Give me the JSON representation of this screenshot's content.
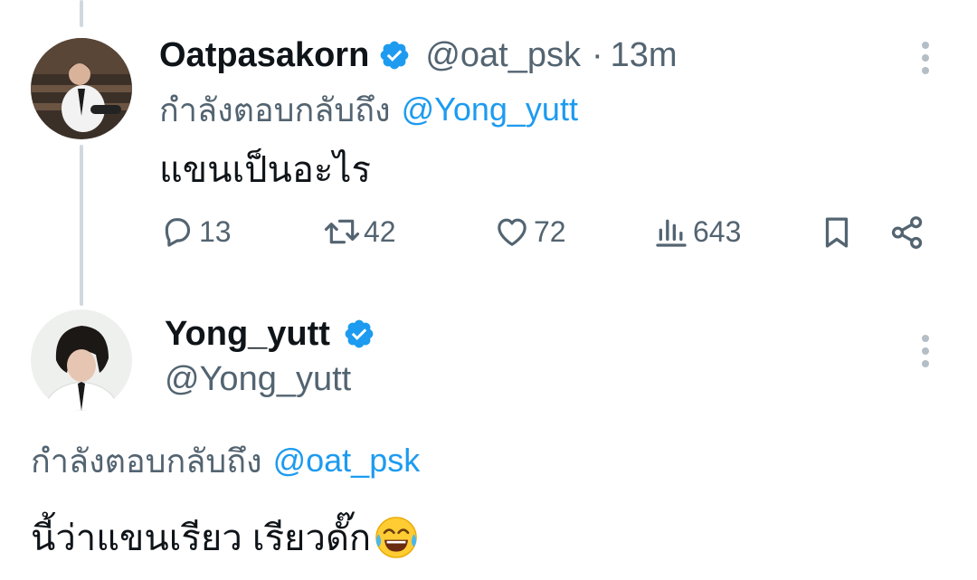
{
  "tweets": [
    {
      "author": {
        "display_name": "Oatpasakorn",
        "handle": "@oat_psk",
        "verified": true
      },
      "separator": "·",
      "time": "13m",
      "replying_prefix": "กำลังตอบกลับถึง",
      "replying_to": "@Yong_yutt",
      "text": "แขนเป็นอะไร",
      "stats": {
        "replies": "13",
        "retweets": "42",
        "likes": "72",
        "views": "643"
      }
    },
    {
      "author": {
        "display_name": "Yong_yutt",
        "handle": "@Yong_yutt",
        "verified": true
      },
      "replying_prefix": "กำลังตอบกลับถึง",
      "replying_to": "@oat_psk",
      "text": "นี้ว่าแขนเรียว เรียวดั๊ก"
    }
  ],
  "icons": {
    "verified": "verified-badge-icon",
    "reply": "reply-icon",
    "retweet": "retweet-icon",
    "like": "heart-icon",
    "views": "views-icon",
    "bookmark": "bookmark-icon",
    "share": "share-icon",
    "more": "more-vertical-icon",
    "emoji": "tears-of-joy-emoji"
  },
  "colors": {
    "accent": "#1d9bf0",
    "secondary_text": "#536471",
    "primary_text": "#0f1419",
    "thread_line": "#cfd9de"
  }
}
